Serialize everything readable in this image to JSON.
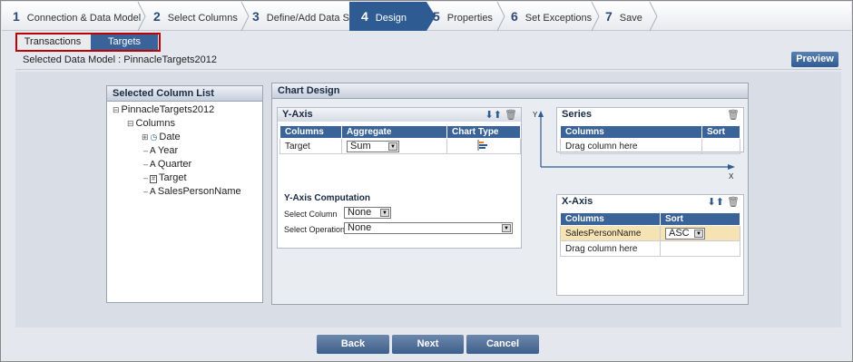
{
  "wizard": {
    "steps": [
      {
        "num": "1",
        "label": "Connection & Data Model"
      },
      {
        "num": "2",
        "label": "Select Columns"
      },
      {
        "num": "3",
        "label": "Define/Add Data Set"
      },
      {
        "num": "4",
        "label": "Design"
      },
      {
        "num": "5",
        "label": "Properties"
      },
      {
        "num": "6",
        "label": "Set Exceptions"
      },
      {
        "num": "7",
        "label": "Save"
      }
    ]
  },
  "tabs": {
    "transactions": "Transactions",
    "targets": "Targets"
  },
  "model": {
    "label": "Selected Data Model : PinnacleTargets2012",
    "preview": "Preview"
  },
  "column_list": {
    "title": "Selected Column List",
    "root": "PinnacleTargets2012",
    "folder": "Columns",
    "items": [
      "Date",
      "Year",
      "Quarter",
      "Target",
      "SalesPersonName"
    ]
  },
  "chart_design": {
    "title": "Chart Design",
    "yaxis": {
      "title": "Y-Axis",
      "headers": [
        "Columns",
        "Aggregate",
        "Chart Type"
      ],
      "row": {
        "column": "Target",
        "aggregate": "Sum"
      }
    },
    "computation": {
      "title": "Y-Axis Computation",
      "select_column_label": "Select Column",
      "select_column_value": "None",
      "select_operation_label": "Select Operation",
      "select_operation_value": "None"
    },
    "axis_y_letter": "Y",
    "axis_x_letter": "X",
    "series": {
      "title": "Series",
      "headers": [
        "Columns",
        "Sort"
      ],
      "placeholder": "Drag column here"
    },
    "xaxis": {
      "title": "X-Axis",
      "headers": [
        "Columns",
        "Sort"
      ],
      "row": {
        "column": "SalesPersonName",
        "sort": "ASC"
      },
      "placeholder": "Drag column here"
    }
  },
  "buttons": {
    "back": "Back",
    "next": "Next",
    "cancel": "Cancel"
  },
  "colors": {
    "accent": "#2f5b93",
    "highlight_row": "#f6e3b4",
    "tab_outline": "#c00000"
  }
}
